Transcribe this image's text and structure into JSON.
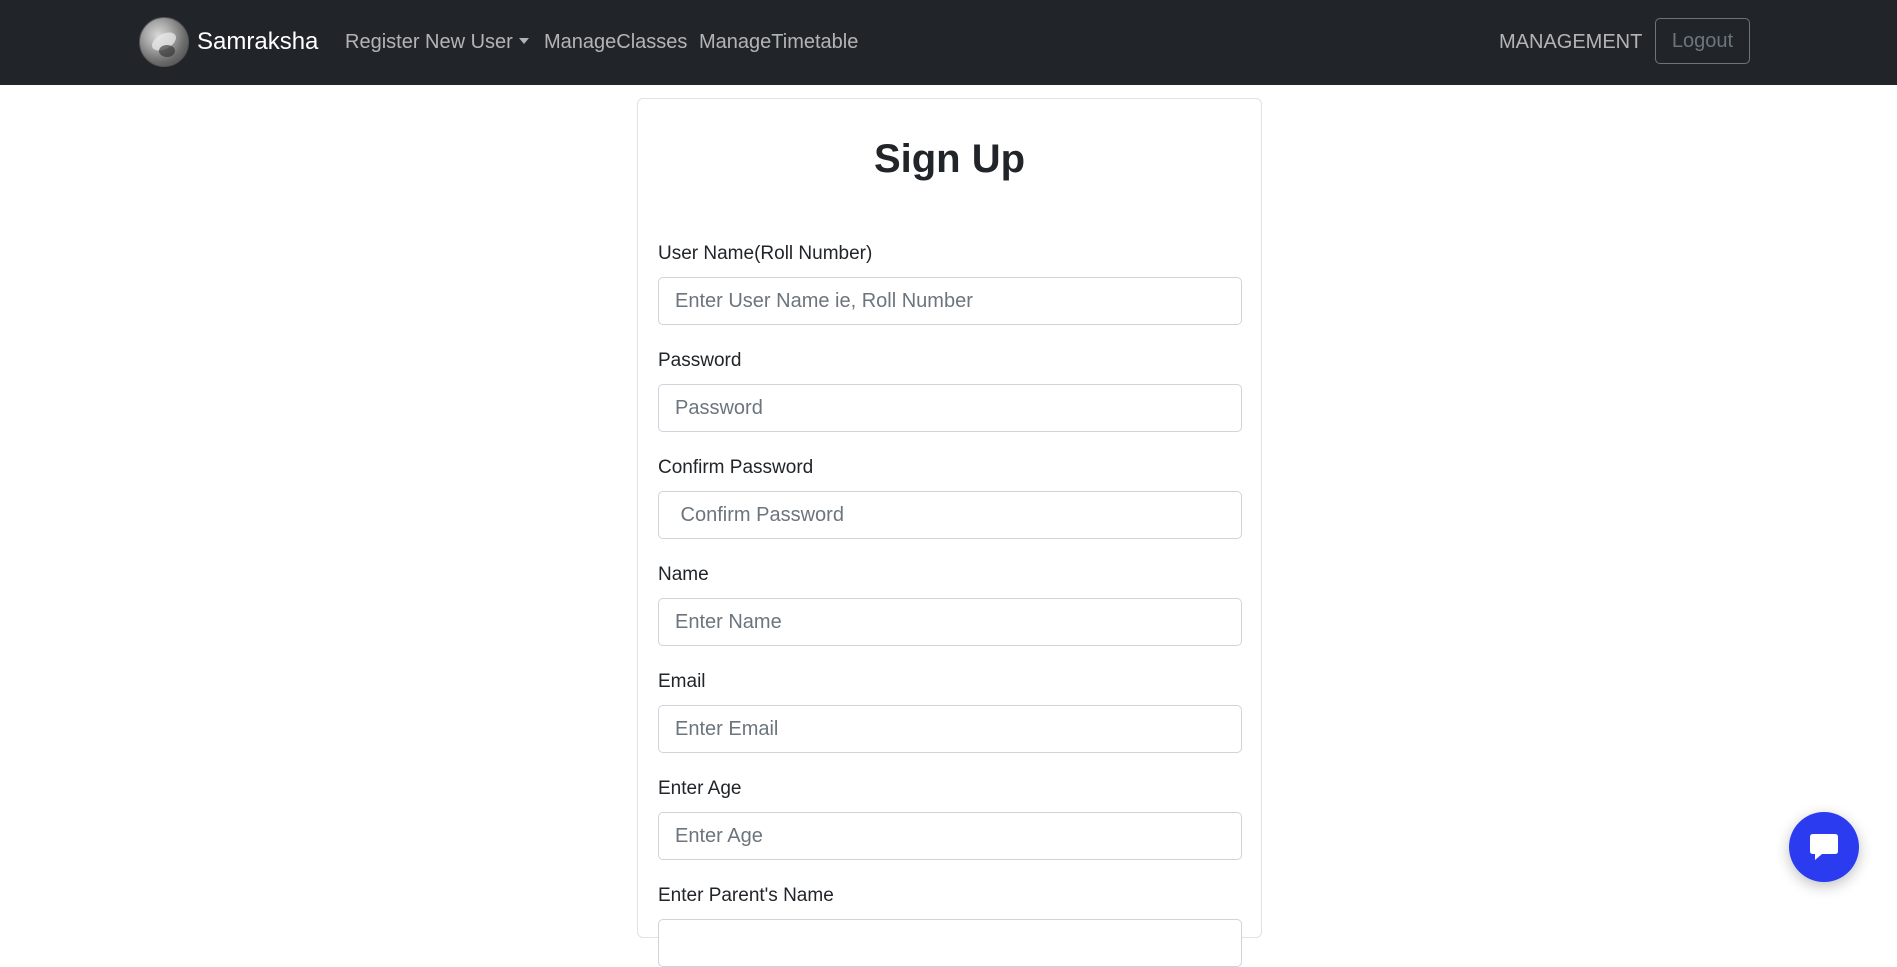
{
  "navbar": {
    "brand_name": "Samraksha",
    "links": [
      {
        "label": "Register New User"
      },
      {
        "label": "ManageClasses"
      },
      {
        "label": "ManageTimetable"
      }
    ],
    "role_label": "MANAGEMENT",
    "logout_label": "Logout"
  },
  "form": {
    "title": "Sign Up",
    "fields": [
      {
        "label": "User Name(Roll Number)",
        "placeholder": "Enter User Name ie, Roll Number"
      },
      {
        "label": "Password",
        "placeholder": "Password"
      },
      {
        "label": "Confirm Password",
        "placeholder": " Confirm Password"
      },
      {
        "label": "Name",
        "placeholder": "Enter Name"
      },
      {
        "label": "Email",
        "placeholder": "Enter Email"
      },
      {
        "label": "Enter Age",
        "placeholder": "Enter Age"
      },
      {
        "label": "Enter Parent's Name",
        "placeholder": ""
      }
    ]
  },
  "chat_widget": {
    "icon": "chat-icon",
    "color": "#2b3bf0"
  },
  "colors": {
    "navbar_bg": "#212529",
    "brand_text": "#ffffff",
    "nav_link": "rgba(255,255,255,0.65)"
  }
}
